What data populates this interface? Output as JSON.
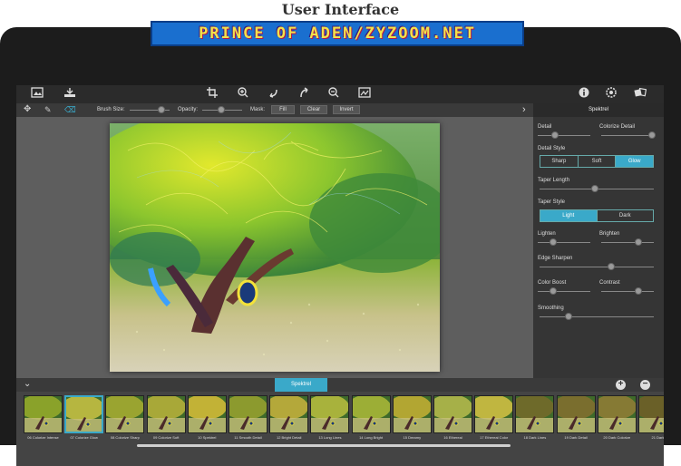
{
  "page": {
    "heading": "User Interface",
    "banner": "PRINCE OF ADEN/ZYZOOM.NET"
  },
  "toolbar": {
    "left_icons": [
      "image-icon",
      "save-icon"
    ],
    "center_icons": [
      "crop-icon",
      "zoom-in-icon",
      "undo-icon",
      "redo-icon",
      "zoom-out-icon",
      "fit-icon"
    ],
    "right_icons": [
      "info-icon",
      "settings-icon",
      "effects-icon"
    ]
  },
  "options": {
    "brush_size_label": "Brush Size:",
    "opacity_label": "Opacity:",
    "mask_label": "Mask:",
    "fill": "Fill",
    "clear": "Clear",
    "invert": "Invert",
    "collapse_arrow": "›"
  },
  "panel": {
    "title": "Spektrel",
    "detail": "Detail",
    "colorize_detail": "Colorize Detail",
    "detail_style": "Detail Style",
    "detail_style_options": [
      "Sharp",
      "Soft",
      "Glow"
    ],
    "detail_style_selected": "Glow",
    "taper_length": "Taper Length",
    "taper_style": "Taper Style",
    "taper_style_options": [
      "Light",
      "Dark"
    ],
    "taper_style_selected": "Light",
    "lighten": "Lighten",
    "brighten": "Brighten",
    "edge_sharpen": "Edge Sharpen",
    "color_boost": "Color Boost",
    "contrast": "Contrast",
    "smoothing": "Smoothing",
    "values": {
      "detail": 0.3,
      "colorize_detail": 1.0,
      "taper_length": 0.45,
      "lighten": 0.28,
      "brighten": 0.7,
      "edge_sharpen": 0.6,
      "color_boost": 0.28,
      "contrast": 0.7,
      "smoothing": 0.25
    }
  },
  "strip": {
    "tab": "Spektrel",
    "add": "+",
    "remove": "−",
    "collapse": "⌄",
    "thumbs": [
      "06 Colorize Intense",
      "07 Colorize Glow",
      "08 Colorize Sharp",
      "09 Colorize Soft",
      "10 Spektrel",
      "11 Smooth Detail",
      "12 Bright Detail",
      "13 Long Lines",
      "14 Long Bright",
      "15 Dreamy",
      "16 Ethereal",
      "17 Ethereal Color",
      "18 Dark Lines",
      "19 Dark Detail",
      "20 Dark Colorize",
      "21 Dark"
    ],
    "selected_index": 1
  }
}
